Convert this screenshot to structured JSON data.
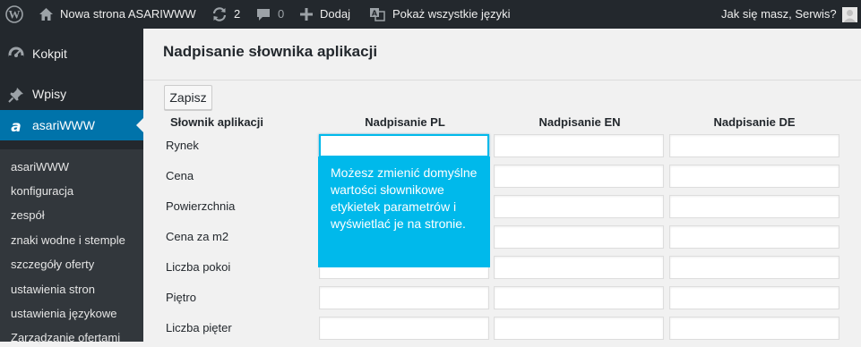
{
  "admin_bar": {
    "site_name": "Nowa strona ASARIWWW",
    "updates_count": "2",
    "comments_count": "0",
    "new_label": "Dodaj",
    "languages_label": "Pokaż wszystkie języki",
    "greeting": "Jak się masz, Serwis?"
  },
  "sidebar": {
    "top_items": [
      {
        "label": "Kokpit",
        "icon": "dashboard-icon"
      },
      {
        "label": "Wpisy",
        "icon": "pin-icon"
      },
      {
        "label": "asariWWW",
        "icon": "asari-a-icon"
      }
    ],
    "sub_items": [
      "asariWWW",
      "konfiguracja",
      "zespół",
      "znaki wodne i stemple",
      "szczegóły oferty",
      "ustawienia stron",
      "ustawienia językowe",
      "Zarządzanie ofertami"
    ]
  },
  "page": {
    "title": "Nadpisanie słownika aplikacji",
    "save_label": "Zapisz",
    "columns": [
      "Słownik aplikacji",
      "Nadpisanie PL",
      "Nadpisanie EN",
      "Nadpisanie DE"
    ],
    "rows": [
      "Rynek",
      "Cena",
      "Powierzchnia",
      "Cena za m2",
      "Liczba pokoi",
      "Piętro",
      "Liczba pięter"
    ],
    "tooltip": "Możesz zmienić domyślne wartości słownikowe etykietek parametrów i wyświetlać je na stronie."
  },
  "colors": {
    "admin_bar_bg": "#23282d",
    "accent": "#0073aa",
    "tooltip_bg": "#00b9eb"
  }
}
